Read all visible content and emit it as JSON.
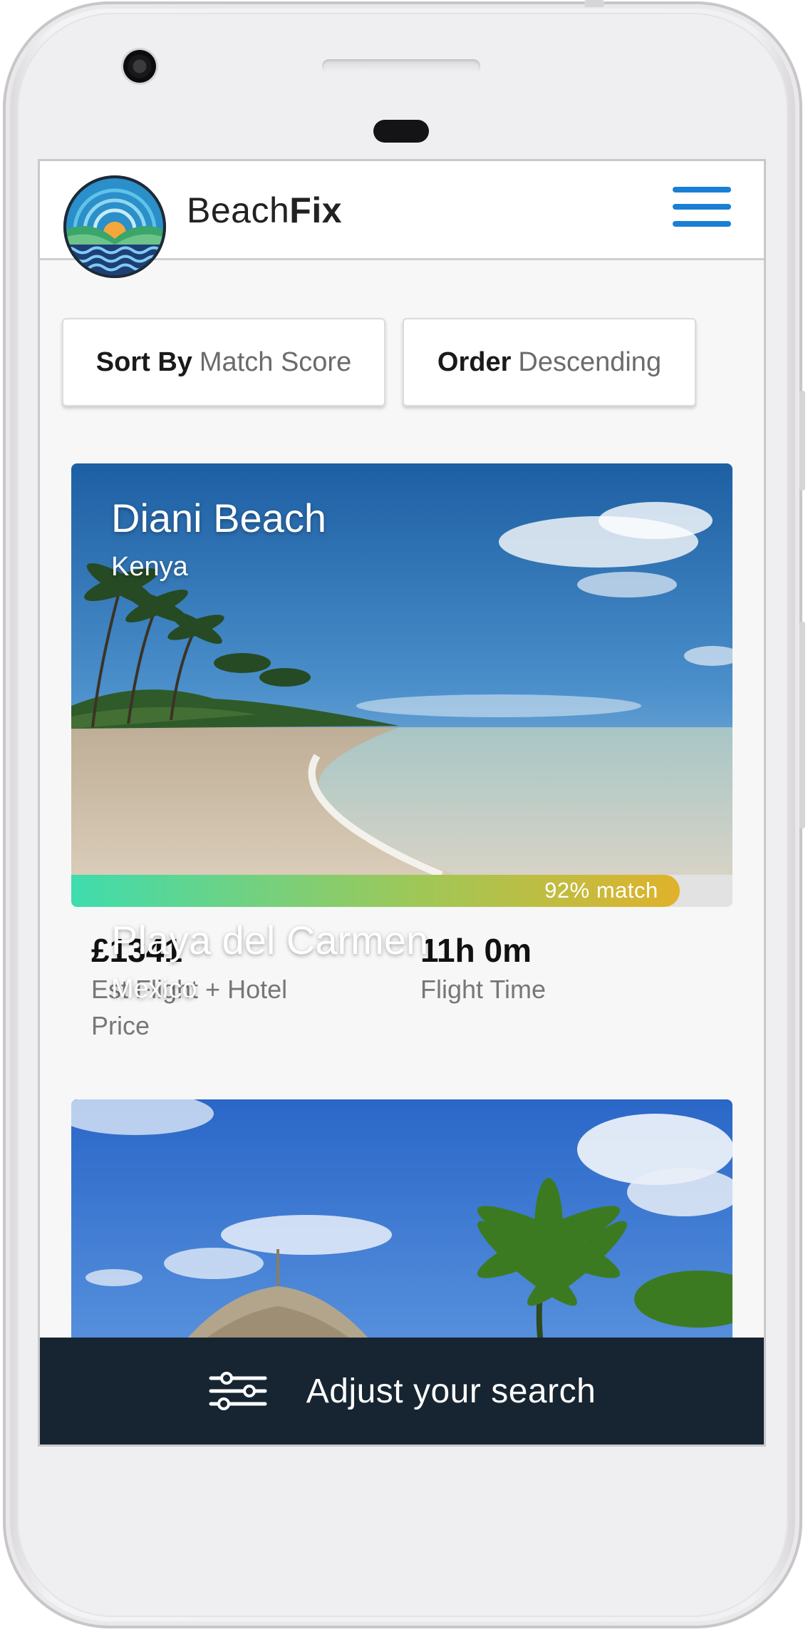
{
  "app": {
    "brand_light": "Beach",
    "brand_bold": "Fix",
    "accent_color": "#1a7fd4",
    "bar_color": "#172431"
  },
  "header": {
    "logo_icon": "beachfix-logo-icon",
    "menu_icon": "hamburger-menu-icon"
  },
  "controls": {
    "sort_label": "Sort By",
    "sort_value": "Match Score",
    "order_label": "Order",
    "order_value": "Descending"
  },
  "results": [
    {
      "title": "Diani Beach",
      "country": "Kenya",
      "match_text": "92% match",
      "match_fraction": 0.92,
      "price": "£1341",
      "price_label": "Est Flight + Hotel Price",
      "flight_time": "11h 0m",
      "flight_label": "Flight Time"
    },
    {
      "title": "Playa del Carmen",
      "country": "Mexico"
    }
  ],
  "footer": {
    "adjust_label": "Adjust your search",
    "adjust_icon": "sliders-icon"
  }
}
